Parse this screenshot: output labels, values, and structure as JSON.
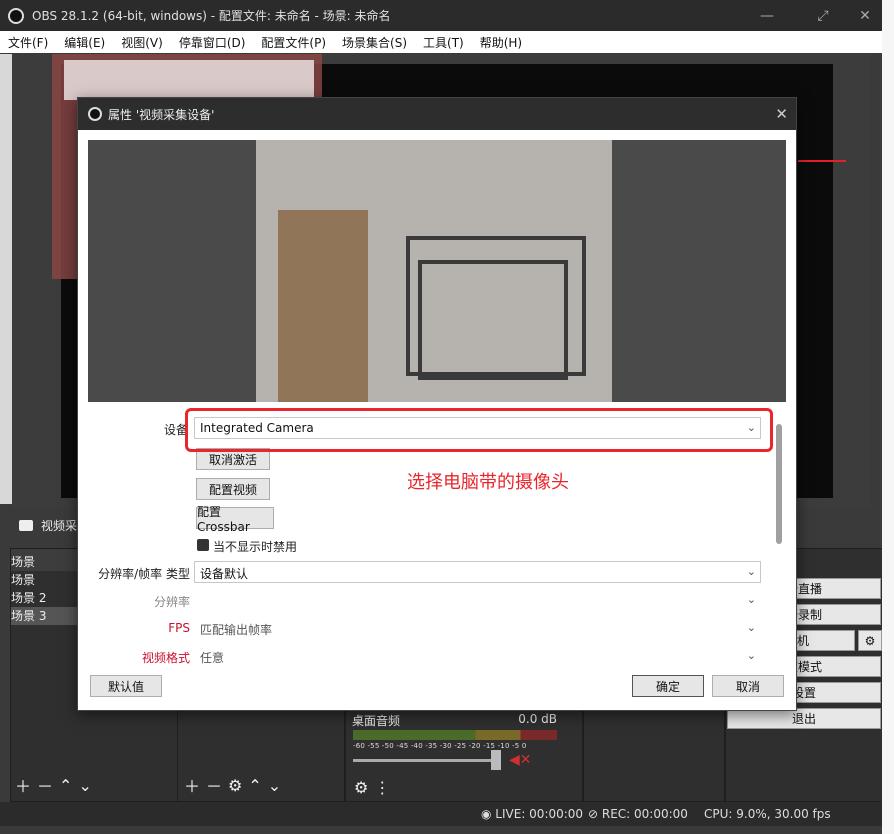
{
  "obs_window": {
    "title": "OBS 28.1.2 (64-bit, windows) - 配置文件: 未命名 - 场景: 未命名",
    "menu": [
      "文件(F)",
      "编辑(E)",
      "视图(V)",
      "停靠窗口(D)",
      "配置文件(P)",
      "场景集合(S)",
      "工具(T)",
      "帮助(H)"
    ],
    "source_label": "视频采",
    "scenes_title": "场景",
    "scenes": [
      "场景",
      "场景 2",
      "场景 3"
    ],
    "controls": [
      "始直播",
      "始录制",
      "摄像机",
      "室模式",
      "设置",
      "退出"
    ],
    "mixer": {
      "channel": "桌面音频",
      "db": "0.0 dB",
      "scale": "-60 -55 -50 -45 -40 -35 -30 -25 -20 -15 -10 -5 0"
    },
    "status": {
      "live": "LIVE: 00:00:00",
      "rec": "REC: 00:00:00",
      "cpu": "CPU: 9.0%, 30.00 fps"
    }
  },
  "dialog": {
    "title": "属性 '视频采集设备'",
    "device_label": "设备",
    "device_value": "Integrated Camera",
    "btn_deactivate": "取消激活",
    "btn_config_video": "配置视频",
    "btn_config_crossbar": "配置Crossbar",
    "checkbox_label": "当不显示时禁用",
    "res_type_label": "分辨率/帧率 类型",
    "res_type_value": "设备默认",
    "resolution_label": "分辨率",
    "fps_label": "FPS",
    "fps_value": "匹配输出帧率",
    "video_format_label": "视频格式",
    "video_format_value": "任意",
    "btn_defaults": "默认值",
    "btn_ok": "确定",
    "btn_cancel": "取消"
  },
  "annotation": {
    "text": "选择电脑带的摄像头",
    "color": "#e8262b"
  }
}
